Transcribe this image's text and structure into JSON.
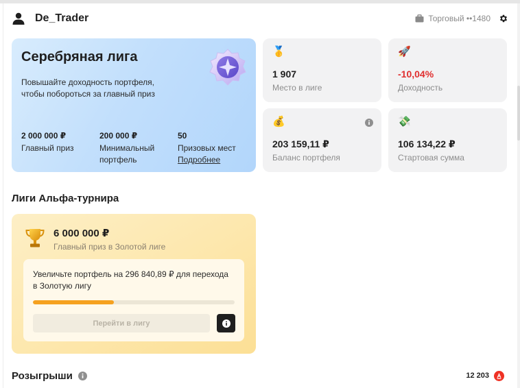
{
  "header": {
    "username": "De_Trader",
    "account_label": "Торговый ••1480"
  },
  "league": {
    "title": "Серебряная лига",
    "description": "Повышайте доходность портфеля, чтобы побороться за главный приз",
    "stats": [
      {
        "value": "2 000 000 ₽",
        "label": "Главный приз"
      },
      {
        "value": "200 000 ₽",
        "label": "Минимальный портфель"
      },
      {
        "value": "50",
        "label": "Призовых мест"
      }
    ],
    "more_link": "Подробнее"
  },
  "tiles": [
    {
      "emoji": "🥇",
      "value": "1 907",
      "label": "Место в лиге"
    },
    {
      "emoji": "🚀",
      "value": "-10,04%",
      "label": "Доходность"
    },
    {
      "emoji": "💰",
      "value": "203 159,11 ₽",
      "label": "Баланс портфеля"
    },
    {
      "emoji": "💸",
      "value": "106 134,22 ₽",
      "label": "Стартовая сумма"
    }
  ],
  "tournament": {
    "section_title": "Лиги Альфа-турнира",
    "gold_prize": "6 000 000 ₽",
    "gold_sub": "Главный приз в Золотой лиге",
    "upgrade_text": "Увеличьте портфель на 296 840,89 ₽ для перехода в Золотую лигу",
    "progress_fraction": 0.4,
    "join_button": "Перейти в лигу"
  },
  "draws": {
    "title": "Розыгрыши",
    "count": "12 203"
  },
  "colors": {
    "negative": "#e02e2e",
    "progress": "#f5a11f",
    "alfa_red": "#ef3124"
  }
}
